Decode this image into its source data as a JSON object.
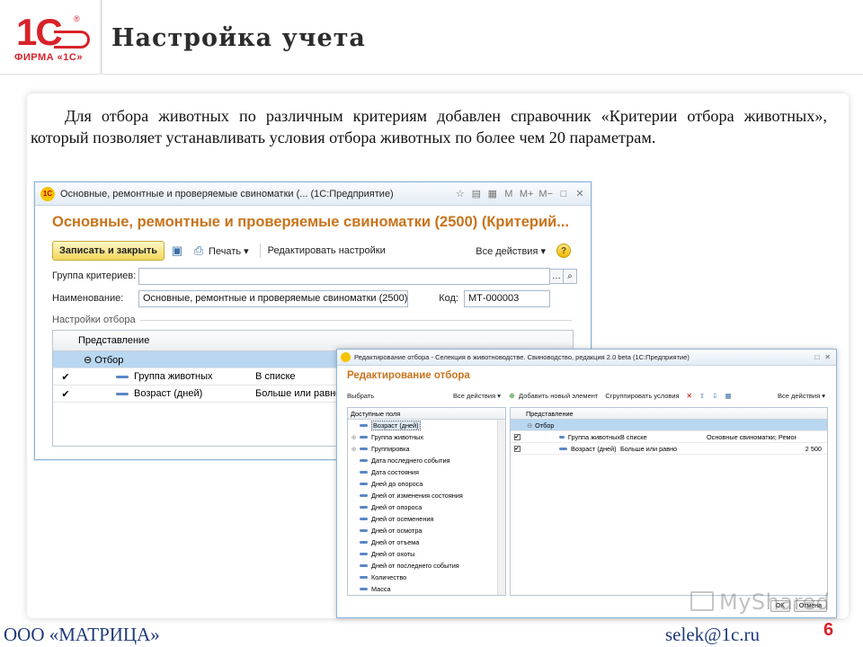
{
  "brand": {
    "logo_mark": "1С",
    "logo_text": "ФИРМА «1С»"
  },
  "slide": {
    "title": "Настройка учета",
    "intro": "Для отбора животных по различным критериям добавлен справочник «Критерии отбора животных», который позволяет устанавливать условия отбора животных по более чем 20 параметрам."
  },
  "window1": {
    "title": "Основные, ремонтные и проверяемые свиноматки (... (1С:Предприятие)",
    "tools": [
      "M",
      "M+",
      "M−"
    ],
    "header": "Основные, ремонтные и проверяемые свиноматки (2500) (Критерий...",
    "toolbar": {
      "save_close": "Записать и закрыть",
      "print": "Печать",
      "edit_settings": "Редактировать настройки",
      "all_actions": "Все действия"
    },
    "form": {
      "group_label": "Группа критериев:",
      "group_value": "",
      "name_label": "Наименование:",
      "name_value": "Основные, ремонтные и проверяемые свиноматки (2500)",
      "code_label": "Код:",
      "code_value": "МТ-000003"
    },
    "settings_legend": "Настройки отбора",
    "grid": {
      "header": "Представление",
      "rows": [
        {
          "expand": "⊖",
          "name": "Отбор",
          "condition": "",
          "checked": false
        },
        {
          "expand": "",
          "name": "Группа животных",
          "condition": "В списке",
          "checked": true
        },
        {
          "expand": "",
          "name": "Возраст (дней)",
          "condition": "Больше или равно",
          "checked": true
        }
      ]
    }
  },
  "window2": {
    "title": "Редактирование отбора - Селекция в животноводстве. Свиноводство, редакция 2.0 beta (1С:Предприятие)",
    "header": "Редактирование отбора",
    "toolbar": {
      "select": "Выбрать",
      "all_actions_left": "Все действия",
      "add_element": "Добавить новый элемент",
      "group_conditions": "Сгруппировать условия",
      "all_actions_right": "Все действия"
    },
    "available_fields_header": "Доступные поля",
    "available_fields": [
      {
        "label": "Возраст (дней)",
        "expandable": false,
        "focused": true
      },
      {
        "label": "Группа животных",
        "expandable": true,
        "focused": false
      },
      {
        "label": "Группировка",
        "expandable": true,
        "focused": false
      },
      {
        "label": "Дата последнего события",
        "expandable": false,
        "focused": false
      },
      {
        "label": "Дата состояния",
        "expandable": false,
        "focused": false
      },
      {
        "label": "Дней до опороса",
        "expandable": false,
        "focused": false
      },
      {
        "label": "Дней от изменения состояния",
        "expandable": false,
        "focused": false
      },
      {
        "label": "Дней от опороса",
        "expandable": false,
        "focused": false
      },
      {
        "label": "Дней от осеменения",
        "expandable": false,
        "focused": false
      },
      {
        "label": "Дней от осмотра",
        "expandable": false,
        "focused": false
      },
      {
        "label": "Дней от отъема",
        "expandable": false,
        "focused": false
      },
      {
        "label": "Дней от охоты",
        "expandable": false,
        "focused": false
      },
      {
        "label": "Дней от последнего события",
        "expandable": false,
        "focused": false
      },
      {
        "label": "Количество",
        "expandable": false,
        "focused": false
      },
      {
        "label": "Масса",
        "expandable": false,
        "focused": false
      }
    ],
    "representation_header": "Представление",
    "filter_rows": [
      {
        "name": "Отбор",
        "condition": "",
        "value": "",
        "number": "",
        "group": true
      },
      {
        "name": "Группа животных",
        "condition": "В списке",
        "value": "Основные свиноматки; Ремон...",
        "number": "",
        "group": false
      },
      {
        "name": "Возраст (дней)",
        "condition": "Больше или равно",
        "value": "",
        "number": "2 500",
        "group": false
      }
    ],
    "footer_buttons": [
      "OK",
      "Отмена"
    ]
  },
  "watermark": "MyShared",
  "footer": {
    "org": "ООО «МАТРИЦА»",
    "email": "selek@1c.ru",
    "page": "6"
  },
  "colors": {
    "accent": "#d8222a",
    "header_orange": "#c8731b",
    "footer_blue": "#1f3a7a",
    "selection": "#b9d7f0"
  }
}
